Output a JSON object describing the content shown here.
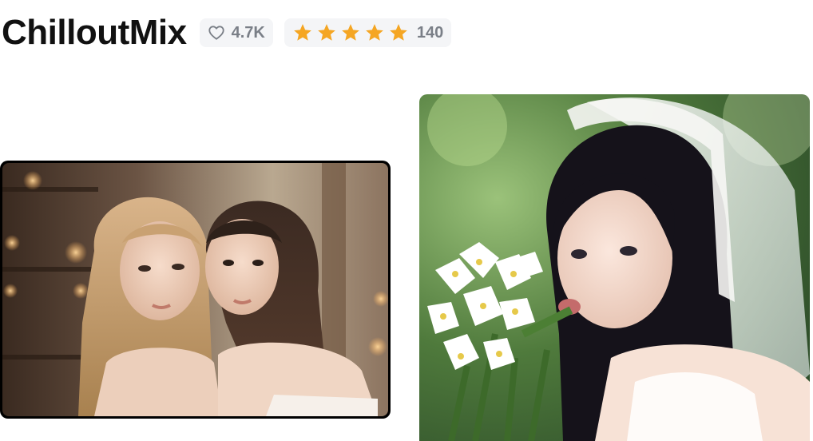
{
  "model": {
    "title": "ChilloutMix",
    "likes": "4.7K",
    "rating": 5,
    "review_count": "140"
  },
  "icons": {
    "like": "heart-outline-icon",
    "star": "star-icon"
  },
  "colors": {
    "title": "#111111",
    "badge_bg": "#f4f5f7",
    "badge_text": "#7a7f87",
    "star": "#f5a623"
  }
}
